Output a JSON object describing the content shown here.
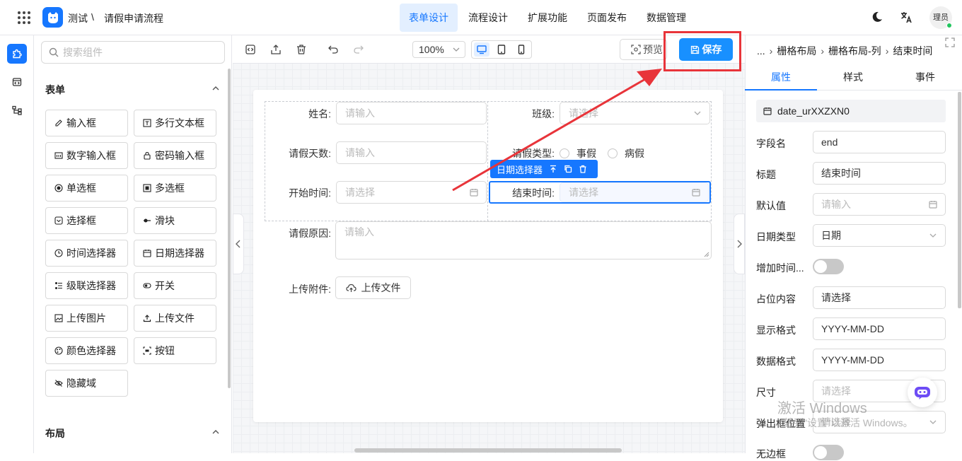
{
  "header": {
    "app_name": "测试",
    "separator": "\\",
    "page_title": "请假申请流程",
    "tabs": [
      {
        "label": "表单设计",
        "active": true
      },
      {
        "label": "流程设计"
      },
      {
        "label": "扩展功能"
      },
      {
        "label": "页面发布"
      },
      {
        "label": "数据管理"
      }
    ],
    "user_name": "理员"
  },
  "component_panel": {
    "search_placeholder": "搜索组件",
    "form_section_title": "表单",
    "layout_section_title": "布局",
    "form_components": [
      {
        "label": "输入框",
        "icon": "pencil-icon"
      },
      {
        "label": "多行文本框",
        "icon": "textarea-icon"
      },
      {
        "label": "数字输入框",
        "icon": "number-icon"
      },
      {
        "label": "密码输入框",
        "icon": "lock-icon"
      },
      {
        "label": "单选框",
        "icon": "radio-icon"
      },
      {
        "label": "多选框",
        "icon": "checkbox-icon"
      },
      {
        "label": "选择框",
        "icon": "select-icon"
      },
      {
        "label": "滑块",
        "icon": "slider-icon"
      },
      {
        "label": "时间选择器",
        "icon": "clock-icon"
      },
      {
        "label": "日期选择器",
        "icon": "calendar-icon"
      },
      {
        "label": "级联选择器",
        "icon": "cascader-icon"
      },
      {
        "label": "开关",
        "icon": "switch-icon"
      },
      {
        "label": "上传图片",
        "icon": "image-icon"
      },
      {
        "label": "上传文件",
        "icon": "upload-icon"
      },
      {
        "label": "颜色选择器",
        "icon": "palette-icon"
      },
      {
        "label": "按钮",
        "icon": "button-icon"
      },
      {
        "label": "隐藏域",
        "icon": "eye-off-icon"
      }
    ]
  },
  "toolbar": {
    "zoom": "100%",
    "preview_label": "预览",
    "save_label": "保存"
  },
  "form": {
    "name_label": "姓名:",
    "name_placeholder": "请输入",
    "class_label": "班级:",
    "class_placeholder": "请选择",
    "days_label": "请假天数:",
    "days_placeholder": "请输入",
    "type_label": "请假类型:",
    "type_options": [
      "事假",
      "病假"
    ],
    "selected_tag": "日期选择器",
    "start_label": "开始时间:",
    "start_placeholder": "请选择",
    "end_label": "结束时间:",
    "end_placeholder": "请选择",
    "reason_label": "请假原因:",
    "reason_placeholder": "请输入",
    "attachment_label": "上传附件:",
    "upload_button": "上传文件"
  },
  "props": {
    "breadcrumb": [
      "...",
      "栅格布局",
      "栅格布局-列",
      "结束时间"
    ],
    "tabs": [
      {
        "label": "属性",
        "active": true
      },
      {
        "label": "样式"
      },
      {
        "label": "事件"
      }
    ],
    "component_id": "date_urXXZXN0",
    "fields": {
      "field_name": {
        "label": "字段名",
        "value": "end"
      },
      "title": {
        "label": "标题",
        "value": "结束时间"
      },
      "default": {
        "label": "默认值",
        "placeholder": "请输入"
      },
      "date_type": {
        "label": "日期类型",
        "value": "日期"
      },
      "add_time": {
        "label": "增加时间...",
        "on": false
      },
      "placeholder": {
        "label": "占位内容",
        "value": "请选择"
      },
      "display_format": {
        "label": "显示格式",
        "value": "YYYY-MM-DD"
      },
      "data_format": {
        "label": "数据格式",
        "value": "YYYY-MM-DD"
      },
      "size": {
        "label": "尺寸",
        "placeholder": "请选择"
      },
      "popup_position": {
        "label": "弹出框位置",
        "placeholder": "请选择"
      },
      "borderless": {
        "label": "无边框",
        "on": false
      }
    }
  },
  "watermark": {
    "line1": "激活 Windows",
    "line2": "转到\"设置\"以激活 Windows。"
  },
  "colors": {
    "accent": "#1677ff",
    "save_button": "#1890ff",
    "highlight": "#e8343a"
  }
}
